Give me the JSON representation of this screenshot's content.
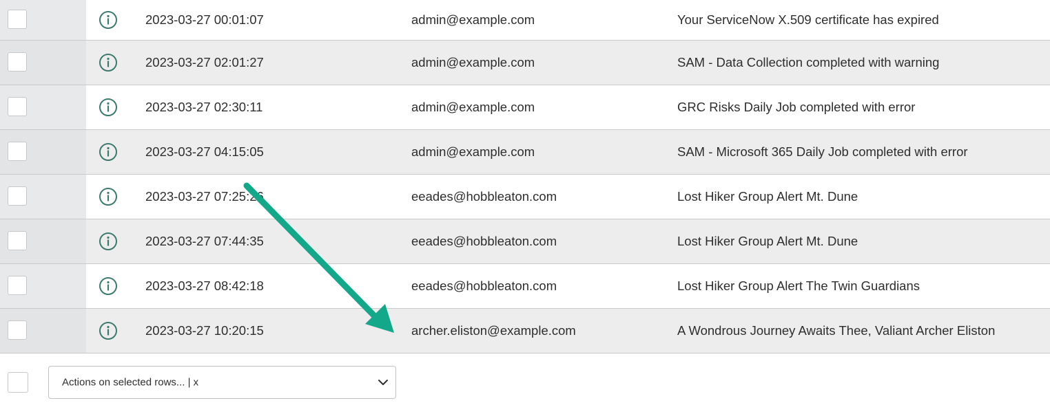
{
  "rows": [
    {
      "date": "2023-03-27 00:01:07",
      "user": "admin@example.com",
      "subject": "Your ServiceNow X.509 certificate has expired"
    },
    {
      "date": "2023-03-27 02:01:27",
      "user": "admin@example.com",
      "subject": "SAM - Data Collection completed with warning"
    },
    {
      "date": "2023-03-27 02:30:11",
      "user": "admin@example.com",
      "subject": "GRC Risks Daily Job completed with error"
    },
    {
      "date": "2023-03-27 04:15:05",
      "user": "admin@example.com",
      "subject": "SAM - Microsoft 365 Daily Job completed with error"
    },
    {
      "date": "2023-03-27 07:25:26",
      "user": "eeades@hobbleaton.com",
      "subject": "Lost Hiker Group Alert Mt. Dune"
    },
    {
      "date": "2023-03-27 07:44:35",
      "user": "eeades@hobbleaton.com",
      "subject": "Lost Hiker Group Alert Mt. Dune"
    },
    {
      "date": "2023-03-27 08:42:18",
      "user": "eeades@hobbleaton.com",
      "subject": "Lost Hiker Group Alert The Twin Guardians"
    },
    {
      "date": "2023-03-27 10:20:15",
      "user": "archer.eliston@example.com",
      "subject": "A Wondrous Journey Awaits Thee, Valiant Archer Eliston"
    }
  ],
  "footer": {
    "actions_label": "Actions on selected rows... | x"
  },
  "icons": {
    "row_icon": "info-icon",
    "select_icon": "chevron-down-icon",
    "annotation": "arrow-icon"
  },
  "colors": {
    "icon": "#3d7a6e",
    "arrow": "#13a889",
    "row_alt": "#ededed"
  }
}
